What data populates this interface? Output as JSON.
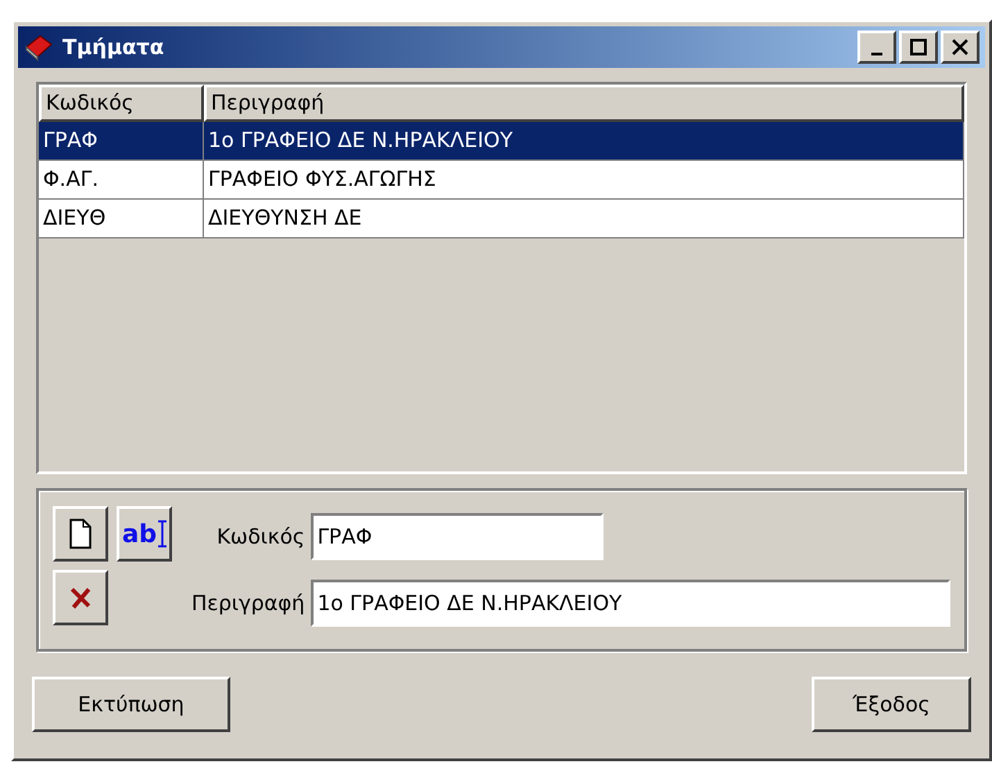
{
  "window": {
    "title": "Τμήματα"
  },
  "table": {
    "columns": [
      "Κωδικός",
      "Περιγραφή"
    ],
    "rows": [
      {
        "cells": [
          "ΓΡΑΦ",
          "1ο ΓΡΑΦΕΙΟ ΔΕ Ν.ΗΡΑΚΛΕΙΟΥ"
        ],
        "selected": true
      },
      {
        "cells": [
          "Φ.ΑΓ.",
          "ΓΡΑΦΕΙΟ ΦΥΣ.ΑΓΩΓΗΣ"
        ],
        "selected": false
      },
      {
        "cells": [
          "ΔΙΕΥΘ",
          "ΔΙΕΥΘΥΝΣΗ ΔΕ"
        ],
        "selected": false
      }
    ]
  },
  "editor": {
    "edit_button": "ab",
    "fields": [
      {
        "label": "Κωδικός",
        "value": "ΓΡΑΦ"
      },
      {
        "label": "Περιγραφή",
        "value": "1ο ΓΡΑΦΕΙΟ ΔΕ Ν.ΗΡΑΚΛΕΙΟΥ"
      }
    ]
  },
  "buttons": {
    "print": "Εκτύπωση",
    "exit": "Έξοδος"
  }
}
